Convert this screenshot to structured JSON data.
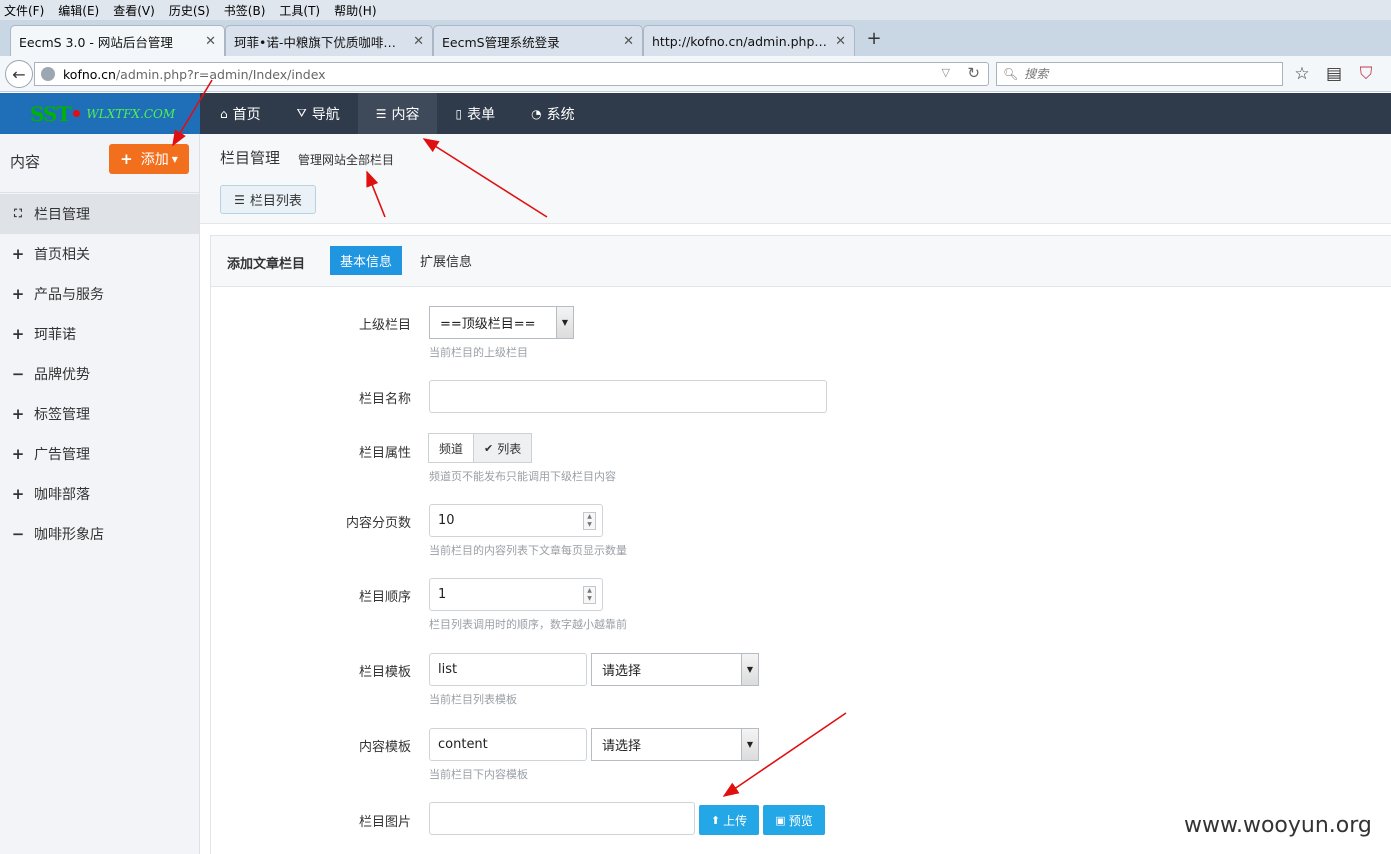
{
  "browser": {
    "menu": [
      "文件(F)",
      "编辑(E)",
      "查看(V)",
      "历史(S)",
      "书签(B)",
      "工具(T)",
      "帮助(H)"
    ],
    "tabs": [
      {
        "title": "EecmS 3.0 - 网站后台管理",
        "active": true
      },
      {
        "title": "珂菲•诺-中粮旗下优质咖啡品牌",
        "active": false
      },
      {
        "title": "EecmS管理系统登录",
        "active": false
      },
      {
        "title": "http://kofno.cn/admin.php?r...",
        "active": false
      }
    ],
    "url_host": "kofno.cn",
    "url_rest": "/admin.php?r=admin/Index/index",
    "search_placeholder": "搜索",
    "icons": [
      "back-icon",
      "globe-icon",
      "reload-icon",
      "search-icon",
      "star-icon",
      "clipboard-icon",
      "pocket-icon"
    ]
  },
  "app": {
    "logo_main": "SST",
    "logo_sub": "WLXTFX.COM",
    "topnav": [
      {
        "label": "首页",
        "icon": "home-icon",
        "active": false
      },
      {
        "label": "导航",
        "icon": "road-icon",
        "active": false
      },
      {
        "label": "内容",
        "icon": "list-icon",
        "active": true
      },
      {
        "label": "表单",
        "icon": "file-icon",
        "active": false
      },
      {
        "label": "系统",
        "icon": "dashboard-icon",
        "active": false
      }
    ]
  },
  "sidebar": {
    "title": "内容",
    "add_label": "添加",
    "items": [
      {
        "label": "栏目管理",
        "icon": "sitemap-icon",
        "active": true
      },
      {
        "label": "首页相关",
        "icon": "plus-icon",
        "active": false
      },
      {
        "label": "产品与服务",
        "icon": "plus-icon",
        "active": false
      },
      {
        "label": "珂菲诺",
        "icon": "plus-icon",
        "active": false
      },
      {
        "label": "品牌优势",
        "icon": "minus-icon",
        "active": false
      },
      {
        "label": "标签管理",
        "icon": "plus-icon",
        "active": false
      },
      {
        "label": "广告管理",
        "icon": "plus-icon",
        "active": false
      },
      {
        "label": "咖啡部落",
        "icon": "plus-icon",
        "active": false
      },
      {
        "label": "咖啡形象店",
        "icon": "minus-icon",
        "active": false
      }
    ]
  },
  "page": {
    "title": "栏目管理",
    "subtitle": "管理网站全部栏目",
    "list_button": "栏目列表"
  },
  "panel": {
    "title": "添加文章栏目",
    "tabs": [
      {
        "label": "基本信息",
        "active": true
      },
      {
        "label": "扩展信息",
        "active": false
      }
    ]
  },
  "form": {
    "parent": {
      "label": "上级栏目",
      "value": "==顶级栏目==",
      "help": "当前栏目的上级栏目"
    },
    "name": {
      "label": "栏目名称",
      "value": ""
    },
    "attr": {
      "label": "栏目属性",
      "options": [
        "频道",
        "列表"
      ],
      "selected": "列表",
      "help": "频道页不能发布只能调用下级栏目内容"
    },
    "pagesize": {
      "label": "内容分页数",
      "value": "10",
      "help": "当前栏目的内容列表下文章每页显示数量"
    },
    "order": {
      "label": "栏目顺序",
      "value": "1",
      "help": "栏目列表调用时的顺序，数字越小越靠前"
    },
    "list_tpl": {
      "label": "栏目模板",
      "value": "list",
      "select": "请选择",
      "help": "当前栏目列表模板"
    },
    "content_tpl": {
      "label": "内容模板",
      "value": "content",
      "select": "请选择",
      "help": "当前栏目下内容模板"
    },
    "image": {
      "label": "栏目图片",
      "value": "",
      "upload": "上传",
      "preview": "预览"
    }
  },
  "watermark": "www.wooyun.org",
  "colors": {
    "accent": "#2196e0",
    "add_button": "#f26f1d",
    "topbar": "#2f3b4a",
    "annotation": "#e01010"
  }
}
